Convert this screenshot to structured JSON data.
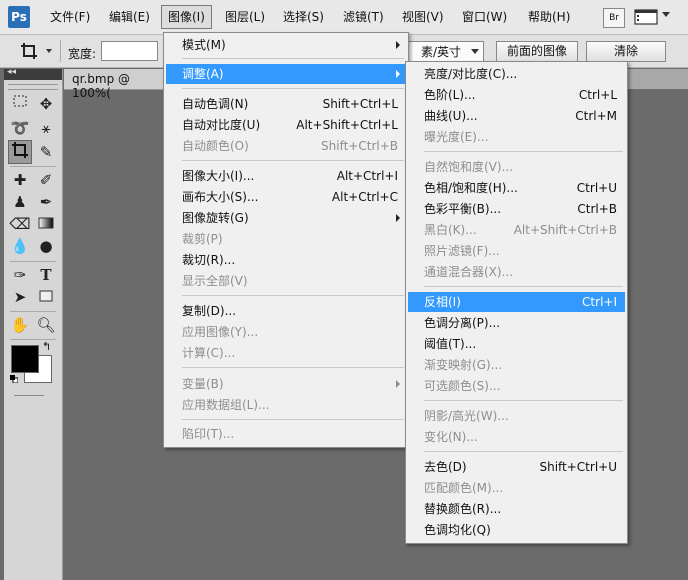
{
  "menubar": {
    "logo": "Ps",
    "items": [
      "文件(F)",
      "编辑(E)",
      "图像(I)",
      "图层(L)",
      "选择(S)",
      "滤镜(T)",
      "视图(V)",
      "窗口(W)",
      "帮助(H)"
    ],
    "bridge": "Br"
  },
  "options": {
    "width_label": "宽度:",
    "width_value": "",
    "unit_select": "素/英寸",
    "front_image_button": "前面的图像",
    "clear_button": "清除"
  },
  "document": {
    "tab_title": "qr.bmp @ 100%("
  },
  "image_menu": [
    {
      "label": "模式(M)",
      "shortcut": "",
      "disabled": false,
      "submenu": true
    },
    {
      "label": "调整(A)",
      "shortcut": "",
      "disabled": false,
      "submenu": true,
      "highlighted": true
    },
    {
      "label": "自动色调(N)",
      "shortcut": "Shift+Ctrl+L",
      "disabled": false
    },
    {
      "label": "自动对比度(U)",
      "shortcut": "Alt+Shift+Ctrl+L",
      "disabled": false
    },
    {
      "label": "自动颜色(O)",
      "shortcut": "Shift+Ctrl+B",
      "disabled": true
    },
    {
      "label": "图像大小(I)...",
      "shortcut": "Alt+Ctrl+I",
      "disabled": false
    },
    {
      "label": "画布大小(S)...",
      "shortcut": "Alt+Ctrl+C",
      "disabled": false
    },
    {
      "label": "图像旋转(G)",
      "shortcut": "",
      "disabled": false,
      "submenu": true
    },
    {
      "label": "裁剪(P)",
      "shortcut": "",
      "disabled": true
    },
    {
      "label": "裁切(R)...",
      "shortcut": "",
      "disabled": false
    },
    {
      "label": "显示全部(V)",
      "shortcut": "",
      "disabled": true
    },
    {
      "label": "复制(D)...",
      "shortcut": "",
      "disabled": false
    },
    {
      "label": "应用图像(Y)...",
      "shortcut": "",
      "disabled": true
    },
    {
      "label": "计算(C)...",
      "shortcut": "",
      "disabled": true
    },
    {
      "label": "变量(B)",
      "shortcut": "",
      "disabled": true,
      "submenu": true
    },
    {
      "label": "应用数据组(L)...",
      "shortcut": "",
      "disabled": true
    },
    {
      "label": "陷印(T)...",
      "shortcut": "",
      "disabled": true
    }
  ],
  "adjust_menu": [
    {
      "label": "亮度/对比度(C)...",
      "shortcut": "",
      "disabled": false
    },
    {
      "label": "色阶(L)...",
      "shortcut": "Ctrl+L",
      "disabled": false
    },
    {
      "label": "曲线(U)...",
      "shortcut": "Ctrl+M",
      "disabled": false
    },
    {
      "label": "曝光度(E)...",
      "shortcut": "",
      "disabled": true
    },
    {
      "label": "自然饱和度(V)...",
      "shortcut": "",
      "disabled": true
    },
    {
      "label": "色相/饱和度(H)...",
      "shortcut": "Ctrl+U",
      "disabled": false
    },
    {
      "label": "色彩平衡(B)...",
      "shortcut": "Ctrl+B",
      "disabled": false
    },
    {
      "label": "黑白(K)...",
      "shortcut": "Alt+Shift+Ctrl+B",
      "disabled": true
    },
    {
      "label": "照片滤镜(F)...",
      "shortcut": "",
      "disabled": true
    },
    {
      "label": "通道混合器(X)...",
      "shortcut": "",
      "disabled": true
    },
    {
      "label": "反相(I)",
      "shortcut": "Ctrl+I",
      "disabled": false,
      "highlighted": true
    },
    {
      "label": "色调分离(P)...",
      "shortcut": "",
      "disabled": false
    },
    {
      "label": "阈值(T)...",
      "shortcut": "",
      "disabled": false
    },
    {
      "label": "渐变映射(G)...",
      "shortcut": "",
      "disabled": true
    },
    {
      "label": "可选颜色(S)...",
      "shortcut": "",
      "disabled": true
    },
    {
      "label": "阴影/高光(W)...",
      "shortcut": "",
      "disabled": true
    },
    {
      "label": "变化(N)...",
      "shortcut": "",
      "disabled": true
    },
    {
      "label": "去色(D)",
      "shortcut": "Shift+Ctrl+U",
      "disabled": false
    },
    {
      "label": "匹配颜色(M)...",
      "shortcut": "",
      "disabled": true
    },
    {
      "label": "替换颜色(R)...",
      "shortcut": "",
      "disabled": false
    },
    {
      "label": "色调均化(Q)",
      "shortcut": "",
      "disabled": false
    }
  ],
  "colors": {
    "highlight": "#3399ff",
    "foreground": "#000000",
    "background": "#ffffff"
  }
}
